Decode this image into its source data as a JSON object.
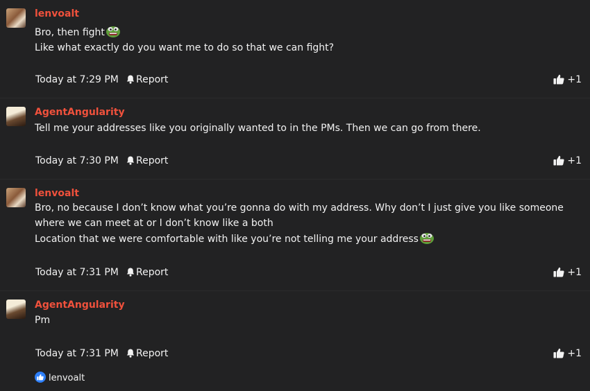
{
  "colors": {
    "background": "#222223",
    "username": "#f0513c",
    "text": "#f2f2f2",
    "reaction": "#2d7ff9"
  },
  "posts": [
    {
      "username": "lenvoalt",
      "lines": [
        "Bro, then fight",
        "Like what exactly do you want me to do so that we can fight?"
      ],
      "emoji_after_line": 0,
      "time": "Today at 7:29 PM",
      "report_label": "Report",
      "like_label": "+1"
    },
    {
      "username": "AgentAngularity",
      "lines": [
        "Tell me your addresses like you originally wanted to in the PMs. Then we can go from there."
      ],
      "time": "Today at 7:30 PM",
      "report_label": "Report",
      "like_label": "+1"
    },
    {
      "username": "lenvoalt",
      "lines": [
        "Bro, no because I don’t know what you’re gonna do with my address. Why don’t I just give you like someone where we can meet at or I don’t know like a both",
        "Location that we were comfortable with like you’re not telling me your address"
      ],
      "emoji_after_line": 1,
      "time": "Today at 7:31 PM",
      "report_label": "Report",
      "like_label": "+1"
    },
    {
      "username": "AgentAngularity",
      "lines": [
        "Pm"
      ],
      "time": "Today at 7:31 PM",
      "report_label": "Report",
      "like_label": "+1"
    }
  ],
  "reactions": {
    "icon": "thumbs-up-icon",
    "user": "lenvoalt"
  }
}
